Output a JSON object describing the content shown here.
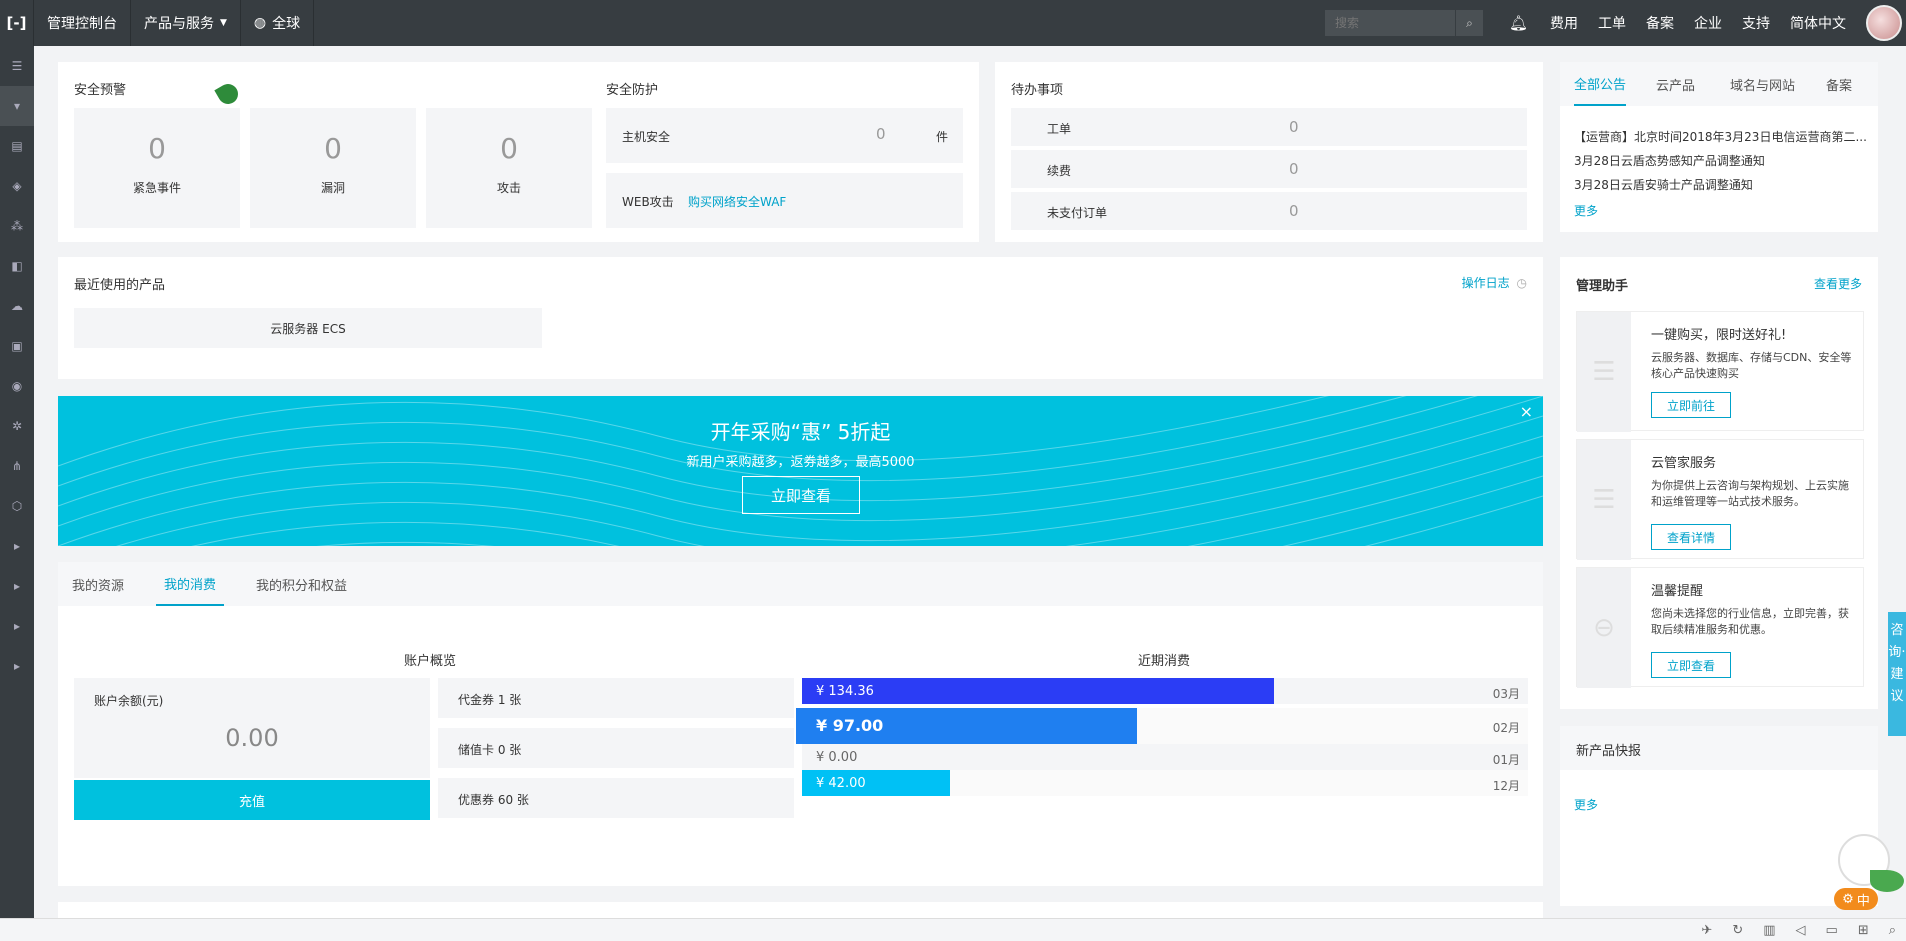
{
  "topbar": {
    "logo": "[-]",
    "console": "管理控制台",
    "products": "产品与服务",
    "region": "全球",
    "search_placeholder": "搜索",
    "links": [
      "费用",
      "工单",
      "备案",
      "企业",
      "支持",
      "简体中文"
    ]
  },
  "security_alert": {
    "title": "安全预警",
    "items": [
      {
        "value": "0",
        "label": "紧急事件"
      },
      {
        "value": "0",
        "label": "漏洞"
      },
      {
        "value": "0",
        "label": "攻击"
      }
    ]
  },
  "security_protect": {
    "title": "安全防护",
    "host_label": "主机安全",
    "host_value": "0",
    "host_unit": "件",
    "waf_label": "WEB攻击",
    "waf_link": "购买网络安全WAF"
  },
  "todo": {
    "title": "待办事项",
    "items": [
      {
        "label": "工单",
        "value": "0"
      },
      {
        "label": "续费",
        "value": "0"
      },
      {
        "label": "未支付订单",
        "value": "0"
      }
    ]
  },
  "announce": {
    "tabs": [
      "全部公告",
      "云产品",
      "域名与网站",
      "备案"
    ],
    "items": [
      "【运营商】北京时间2018年3月23日电信运营商第二...",
      "3月28日云盾态势感知产品调整通知",
      "3月28日云盾安骑士产品调整通知"
    ],
    "more": "更多"
  },
  "recent_products": {
    "title": "最近使用的产品",
    "log_link": "操作日志",
    "item": "云服务器 ECS"
  },
  "banner": {
    "title": "开年采购“惠” 5折起",
    "subtitle": "新用户采购越多，返券越多，最高5000",
    "button": "立即查看",
    "close": "×"
  },
  "resource_tabs": {
    "tabs": [
      "我的资源",
      "我的消费",
      "我的积分和权益"
    ],
    "active": 1
  },
  "account": {
    "title": "账户概览",
    "balance_label": "账户余额(元)",
    "balance": "0.00",
    "recharge": "充值",
    "vouchers": [
      "代金券 1 张",
      "储值卡 0 张",
      "优惠券 60 张"
    ]
  },
  "recent_spend": {
    "title": "近期消费",
    "items": [
      {
        "amount": "¥ 134.36",
        "month": "03月",
        "value": 134.36,
        "color": "#2b3df5"
      },
      {
        "amount": "¥ 97.00",
        "month": "02月",
        "value": 97.0,
        "color": "#1f7ff0"
      },
      {
        "amount": "¥ 0.00",
        "month": "01月",
        "value": 0,
        "color": "#00c1de"
      },
      {
        "amount": "¥ 42.00",
        "month": "12月",
        "value": 42.0,
        "color": "#00c1f5"
      }
    ]
  },
  "assistant": {
    "title": "管理助手",
    "more": "查看更多",
    "cards": [
      {
        "title": "一键购买，限时送好礼!",
        "desc": "云服务器、数据库、存储与CDN、安全等核心产品快速购买",
        "button": "立即前往"
      },
      {
        "title": "云管家服务",
        "desc": "为你提供上云咨询与架构规划、上云实施和运维管理等一站式技术服务。",
        "button": "查看详情"
      },
      {
        "title": "温馨提醒",
        "desc": "您尚未选择您的行业信息，立即完善，获取后续精准服务和优惠。",
        "button": "立即查看"
      }
    ]
  },
  "new_products": {
    "title": "新产品快报",
    "more": "更多"
  },
  "float_widget": {
    "label": "咨询·建议"
  },
  "ime": {
    "label": "中"
  }
}
